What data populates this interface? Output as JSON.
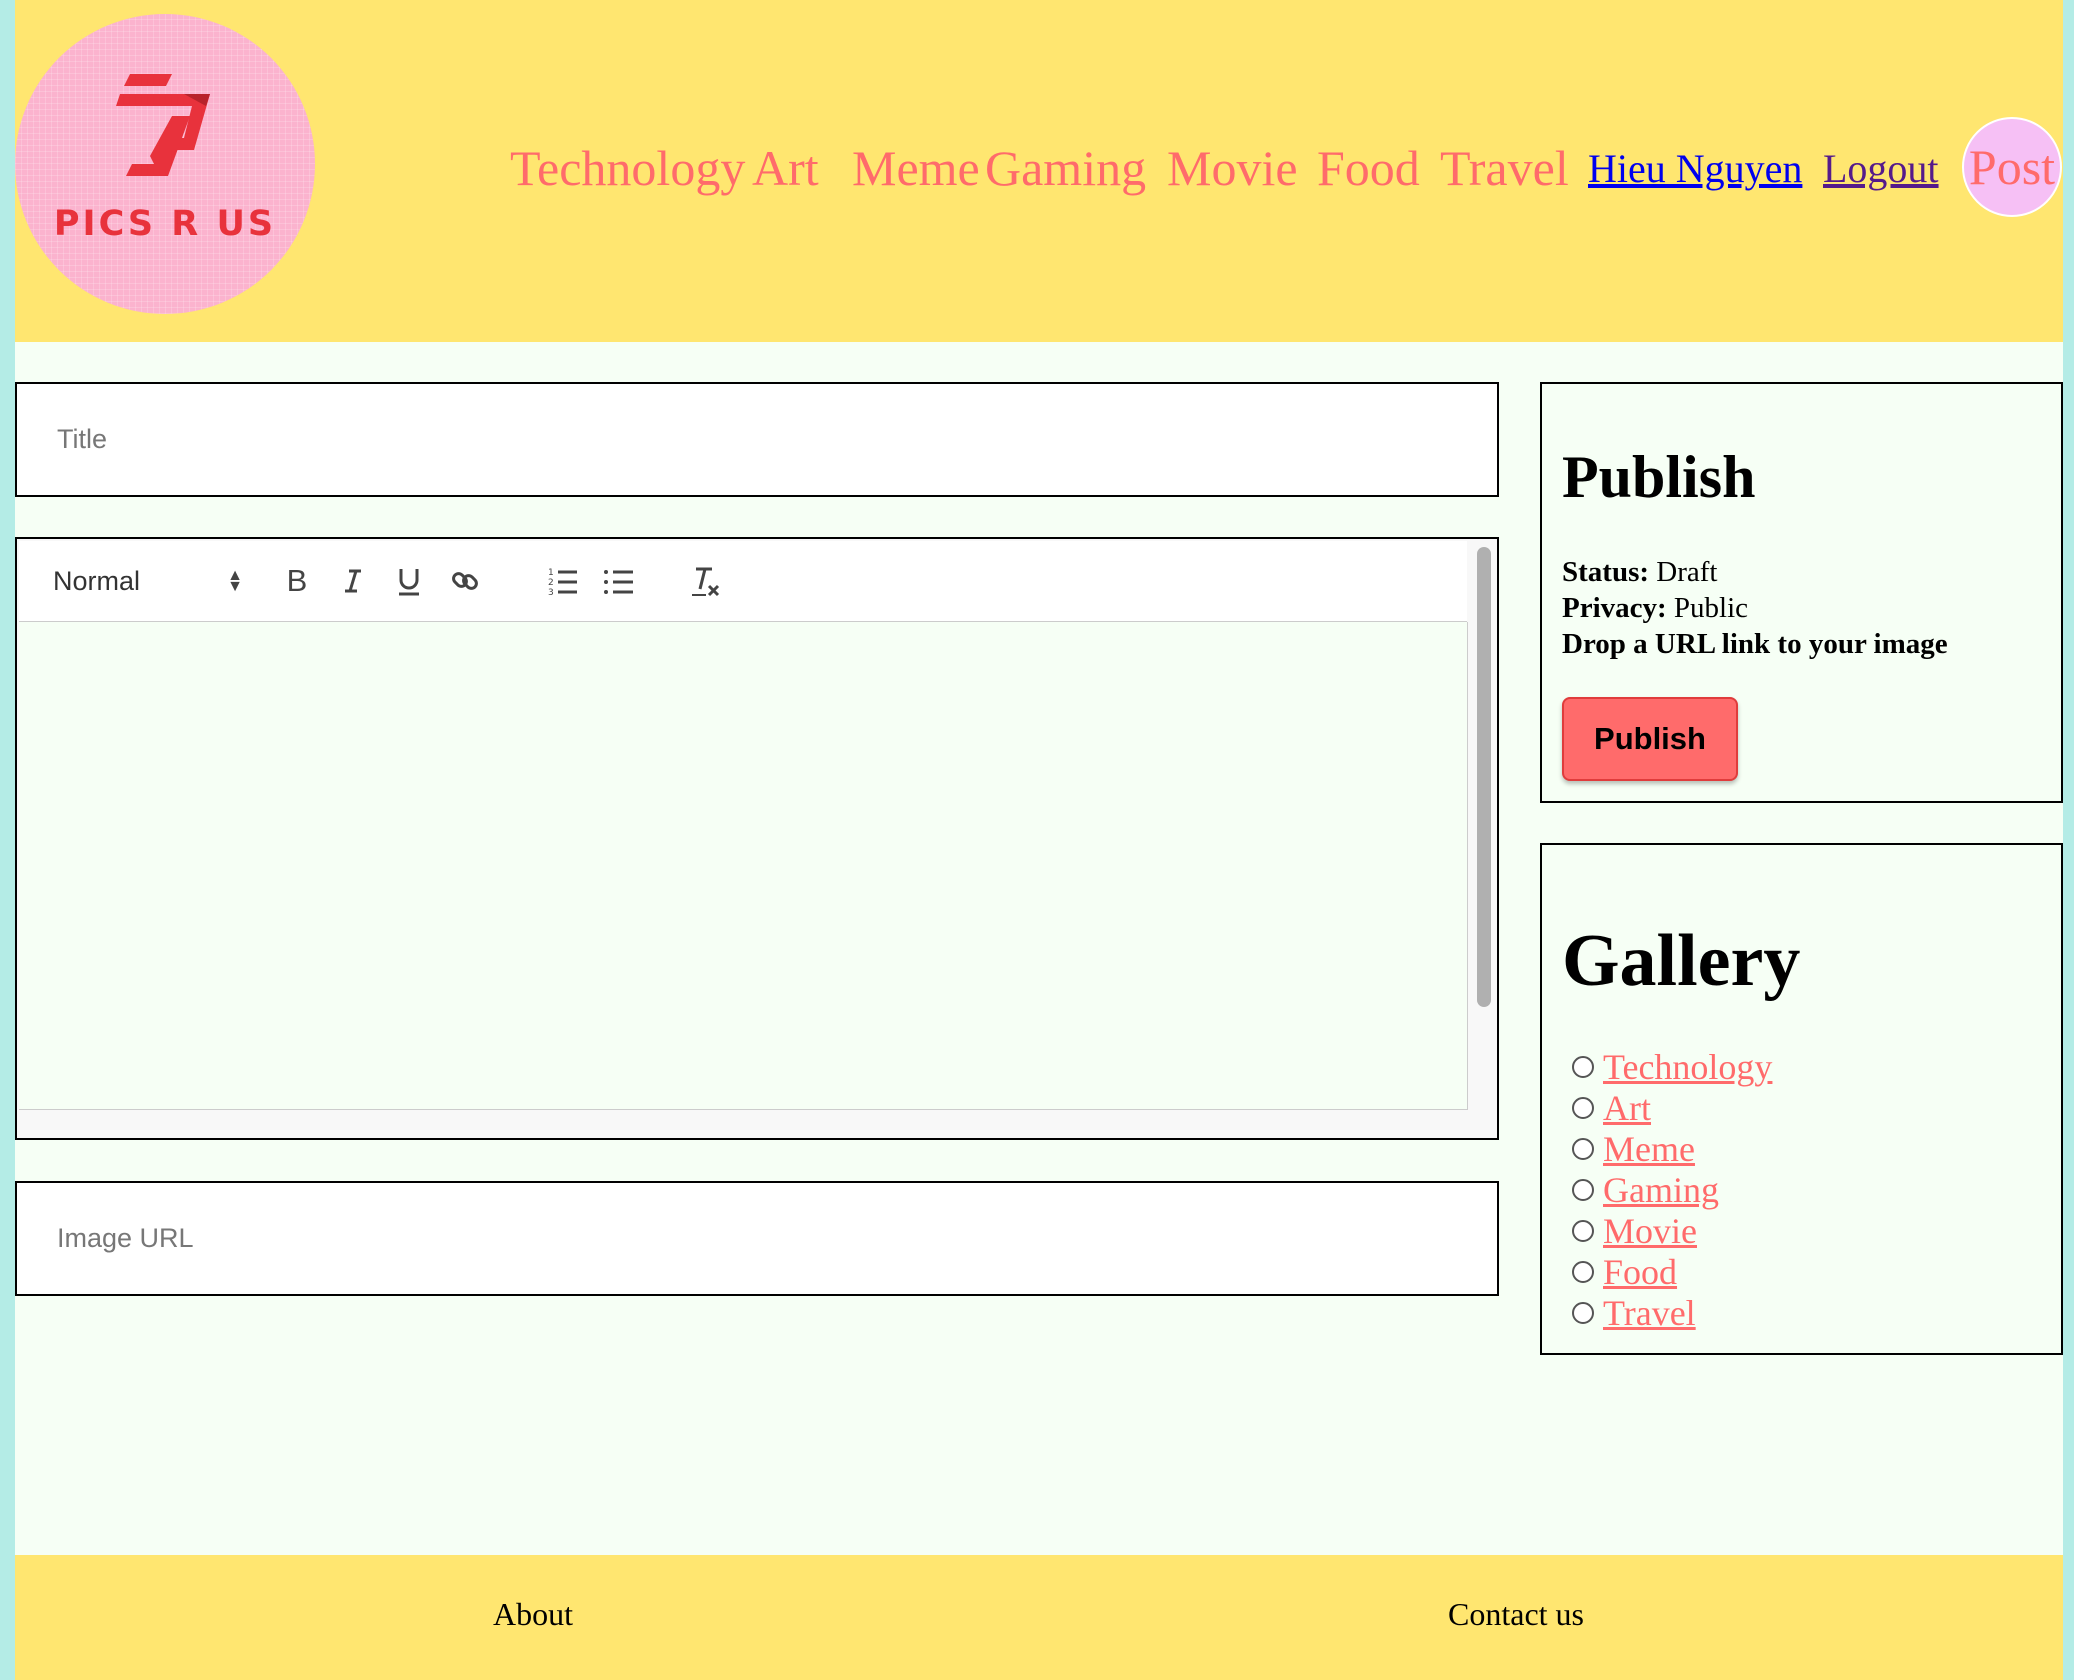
{
  "brand": {
    "logo_text": "PICS R US"
  },
  "nav": {
    "categories": [
      "Technology",
      "Art",
      "Meme",
      "Gaming",
      "Movie",
      "Food",
      "Travel"
    ],
    "user": "Hieu Nguyen",
    "logout": "Logout",
    "post": "Post"
  },
  "form": {
    "title_placeholder": "Title",
    "image_url_placeholder": "Image URL",
    "editor": {
      "heading_select": "Normal",
      "tools": [
        "bold-icon",
        "italic-icon",
        "underline-icon",
        "link-icon",
        "ordered-list-icon",
        "bullet-list-icon",
        "clear-format-icon"
      ]
    }
  },
  "publish": {
    "heading": "Publish",
    "status_label": "Status:",
    "status_value": "Draft",
    "privacy_label": "Privacy:",
    "privacy_value": "Public",
    "hint": "Drop a URL link to your image",
    "button": "Publish"
  },
  "gallery": {
    "heading": "Gallery",
    "items": [
      "Technology",
      "Art",
      "Meme",
      "Gaming",
      "Movie",
      "Food",
      "Travel"
    ]
  },
  "footer": {
    "about": "About",
    "contact": "Contact us"
  },
  "colors": {
    "header_bg": "#ffe670",
    "accent": "#ff6b6b",
    "page_bg": "#f6fff5",
    "side_bg": "#b4ece6"
  }
}
